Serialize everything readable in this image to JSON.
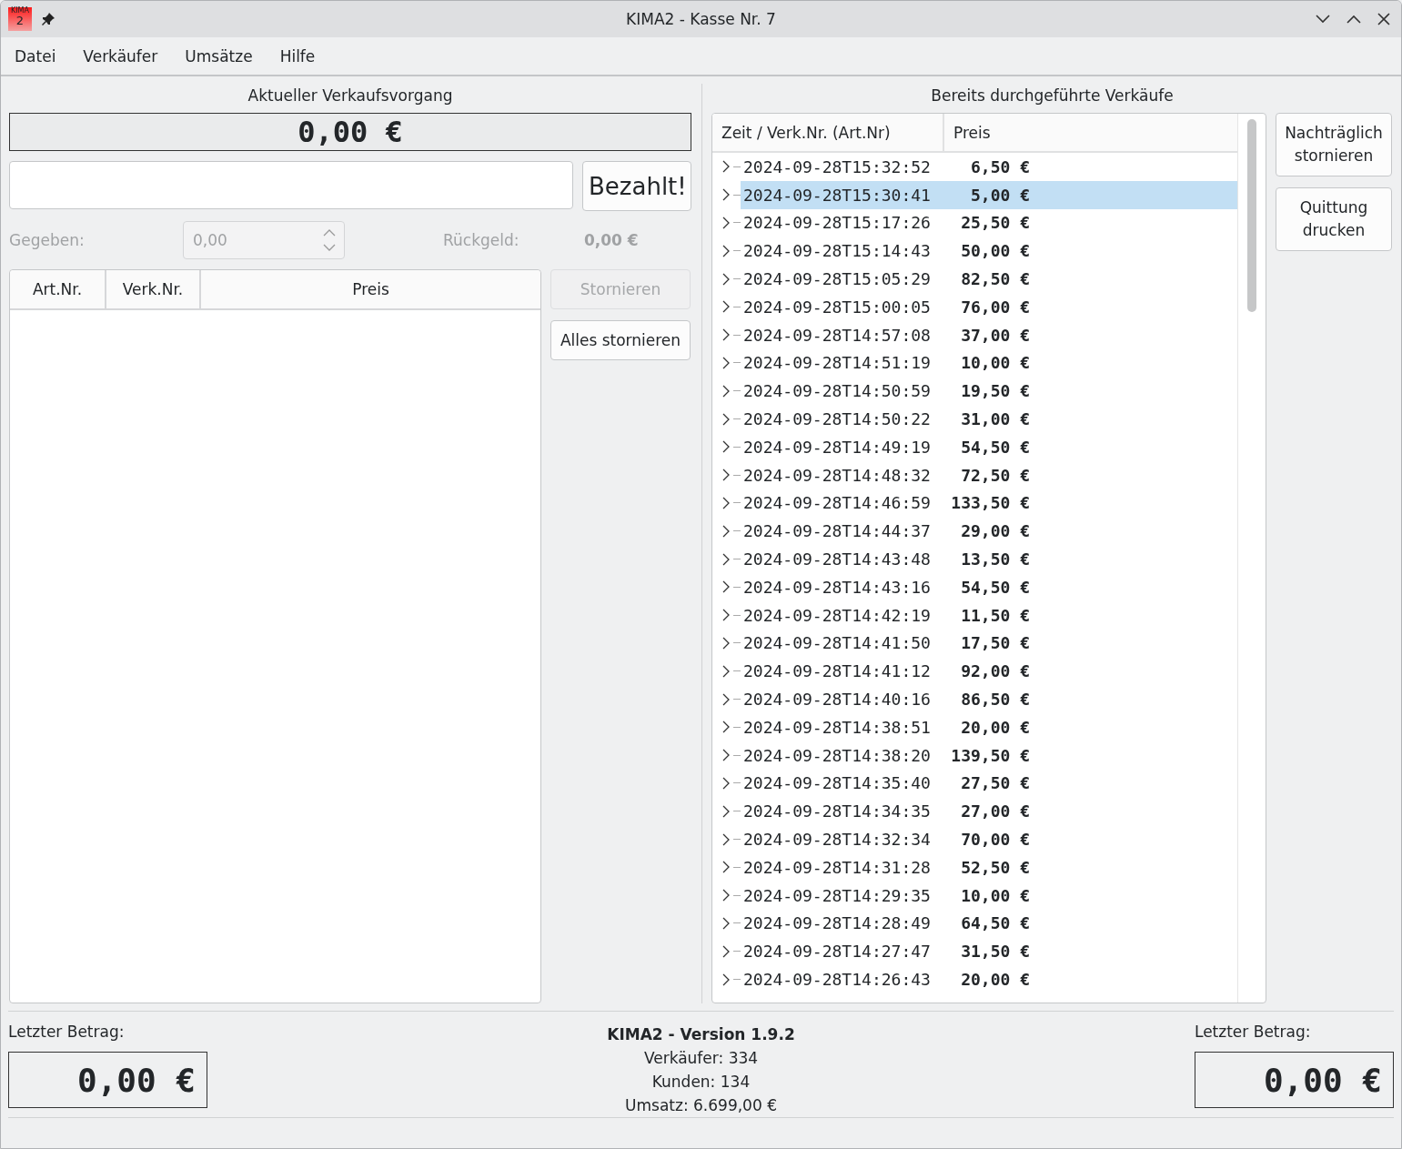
{
  "window": {
    "icon_text": [
      "KIMA",
      "2"
    ],
    "title": "KIMA2 - Kasse Nr. 7"
  },
  "menu": [
    "Datei",
    "Verkäufer",
    "Umsätze",
    "Hilfe"
  ],
  "current_sale": {
    "heading": "Aktueller Verkaufsvorgang",
    "total": "0,00 €",
    "paid_button": "Bezahlt!",
    "given_label": "Gegeben:",
    "given_value": "0,00",
    "given_disabled": true,
    "change_label": "Rückgeld:",
    "change_value": "0,00 €",
    "table": {
      "columns": [
        "Art.Nr.",
        "Verk.Nr.",
        "Preis"
      ]
    },
    "buttons": [
      {
        "label": "Stornieren",
        "disabled": true
      },
      {
        "label": "Alles stornieren",
        "disabled": false
      }
    ]
  },
  "past_sales": {
    "heading": "Bereits durchgeführte Verkäufe",
    "columns": [
      "Zeit / Verk.Nr. (Art.Nr)",
      "Preis"
    ],
    "rows": [
      {
        "time": "2024-09-28T15:32:52",
        "price": "6,50 €",
        "selected": false
      },
      {
        "time": "2024-09-28T15:30:41",
        "price": "5,00 €",
        "selected": true
      },
      {
        "time": "2024-09-28T15:17:26",
        "price": "25,50 €",
        "selected": false
      },
      {
        "time": "2024-09-28T15:14:43",
        "price": "50,00 €",
        "selected": false
      },
      {
        "time": "2024-09-28T15:05:29",
        "price": "82,50 €",
        "selected": false
      },
      {
        "time": "2024-09-28T15:00:05",
        "price": "76,00 €",
        "selected": false
      },
      {
        "time": "2024-09-28T14:57:08",
        "price": "37,00 €",
        "selected": false
      },
      {
        "time": "2024-09-28T14:51:19",
        "price": "10,00 €",
        "selected": false
      },
      {
        "time": "2024-09-28T14:50:59",
        "price": "19,50 €",
        "selected": false
      },
      {
        "time": "2024-09-28T14:50:22",
        "price": "31,00 €",
        "selected": false
      },
      {
        "time": "2024-09-28T14:49:19",
        "price": "54,50 €",
        "selected": false
      },
      {
        "time": "2024-09-28T14:48:32",
        "price": "72,50 €",
        "selected": false
      },
      {
        "time": "2024-09-28T14:46:59",
        "price": "133,50 €",
        "selected": false
      },
      {
        "time": "2024-09-28T14:44:37",
        "price": "29,00 €",
        "selected": false
      },
      {
        "time": "2024-09-28T14:43:48",
        "price": "13,50 €",
        "selected": false
      },
      {
        "time": "2024-09-28T14:43:16",
        "price": "54,50 €",
        "selected": false
      },
      {
        "time": "2024-09-28T14:42:19",
        "price": "11,50 €",
        "selected": false
      },
      {
        "time": "2024-09-28T14:41:50",
        "price": "17,50 €",
        "selected": false
      },
      {
        "time": "2024-09-28T14:41:12",
        "price": "92,00 €",
        "selected": false
      },
      {
        "time": "2024-09-28T14:40:16",
        "price": "86,50 €",
        "selected": false
      },
      {
        "time": "2024-09-28T14:38:51",
        "price": "20,00 €",
        "selected": false
      },
      {
        "time": "2024-09-28T14:38:20",
        "price": "139,50 €",
        "selected": false
      },
      {
        "time": "2024-09-28T14:35:40",
        "price": "27,50 €",
        "selected": false
      },
      {
        "time": "2024-09-28T14:34:35",
        "price": "27,00 €",
        "selected": false
      },
      {
        "time": "2024-09-28T14:32:34",
        "price": "70,00 €",
        "selected": false
      },
      {
        "time": "2024-09-28T14:31:28",
        "price": "52,50 €",
        "selected": false
      },
      {
        "time": "2024-09-28T14:29:35",
        "price": "10,00 €",
        "selected": false
      },
      {
        "time": "2024-09-28T14:28:49",
        "price": "64,50 €",
        "selected": false
      },
      {
        "time": "2024-09-28T14:27:47",
        "price": "31,50 €",
        "selected": false
      },
      {
        "time": "2024-09-28T14:26:43",
        "price": "20,00 €",
        "selected": false
      }
    ],
    "buttons": [
      [
        "Nachträglich",
        "stornieren"
      ],
      [
        "Quittung",
        "drucken"
      ]
    ]
  },
  "footer": {
    "left_label": "Letzter Betrag:",
    "left_value": "0,00 €",
    "version": "KIMA2 - Version 1.9.2",
    "stats": [
      "Verkäufer: 334",
      "Kunden: 134",
      "Umsatz: 6.699,00 €"
    ],
    "right_label": "Letzter Betrag:",
    "right_value": "0,00 €"
  }
}
